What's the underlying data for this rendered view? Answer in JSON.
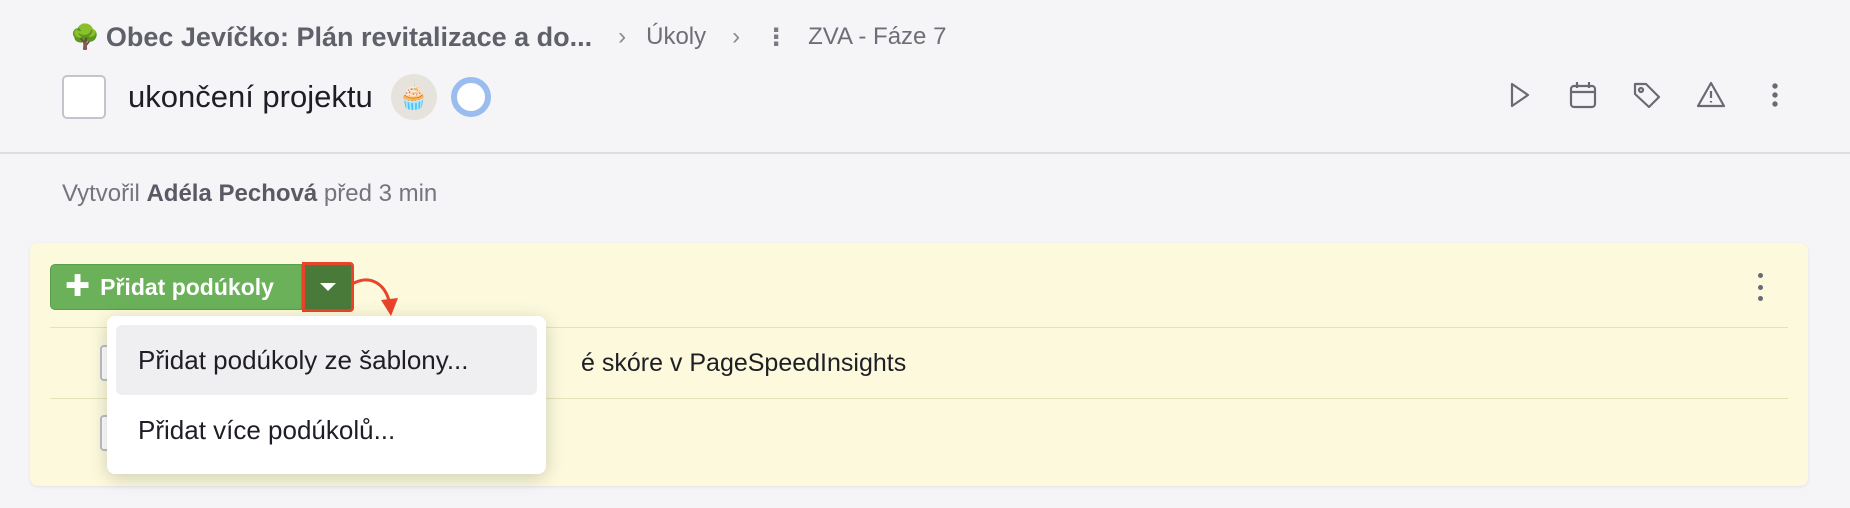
{
  "breadcrumb": {
    "project_icon": "🌳",
    "project": "Obec Jevíčko: Plán revitalizace a do...",
    "section": "Úkoly",
    "current": "ZVA - Fáze 7"
  },
  "task": {
    "title": "ukončení projektu",
    "avatar_emoji": "🧁"
  },
  "toolbar": [
    "play-icon",
    "calendar-icon",
    "tag-icon",
    "warning-icon",
    "more-icon"
  ],
  "meta": {
    "created_prefix": "Vytvořil",
    "author": "Adéla Pechová",
    "created_suffix": "před 3 min"
  },
  "subtasks": {
    "add_label": "Přidat podúkoly",
    "items": [
      {
        "label": "Ověřit skóre v PageSpeedInsights",
        "visible": "é skóre v PageSpeedInsights"
      },
      {
        "label": ""
      }
    ]
  },
  "dropdown": {
    "items": [
      "Přidat podúkoly ze šablony...",
      "Přidat více podúkolů..."
    ]
  },
  "colors": {
    "accent_green": "#6bb159",
    "dark_green": "#4a7a3a",
    "highlight_red": "#e8442a",
    "panel_bg": "#fcf9dc"
  }
}
